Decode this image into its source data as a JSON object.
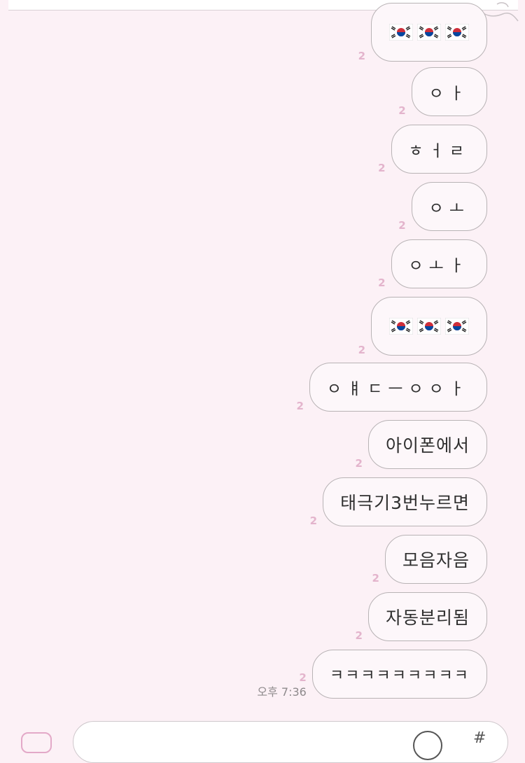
{
  "colors": {
    "background": "#fcf1f6",
    "bubble": "#fdf7fa",
    "unread": "#e3b4cc",
    "border": "#b8b3b5"
  },
  "messages": [
    {
      "text": "",
      "unread": "2",
      "flags": [
        "flag-kr-icon",
        "flag-kr-icon",
        "flag-kr-icon"
      ]
    },
    {
      "text": "ㅇㅏ",
      "unread": "2"
    },
    {
      "text": "ㅎㅓㄹ",
      "unread": "2"
    },
    {
      "text": "ㅇㅗ",
      "unread": "2"
    },
    {
      "text": "ㅇㅗㅏ",
      "unread": "2"
    },
    {
      "text": "",
      "unread": "2",
      "flags": [
        "flag-kr-icon",
        "flag-kr-icon",
        "flag-kr-icon"
      ]
    },
    {
      "text": "ㅇㅒㄷㅡㅇㅇㅏ",
      "unread": "2"
    },
    {
      "text": "아이폰에서",
      "unread": "2"
    },
    {
      "text": "태극기3번누르면",
      "unread": "2"
    },
    {
      "text": "모음자음",
      "unread": "2"
    },
    {
      "text": "자동분리됨",
      "unread": "2"
    },
    {
      "text": "ㅋㅋㅋㅋㅋㅋㅋㅋㅋ",
      "unread": "2",
      "time": "오후 7:36"
    }
  ],
  "input": {
    "hash_label": "#"
  }
}
